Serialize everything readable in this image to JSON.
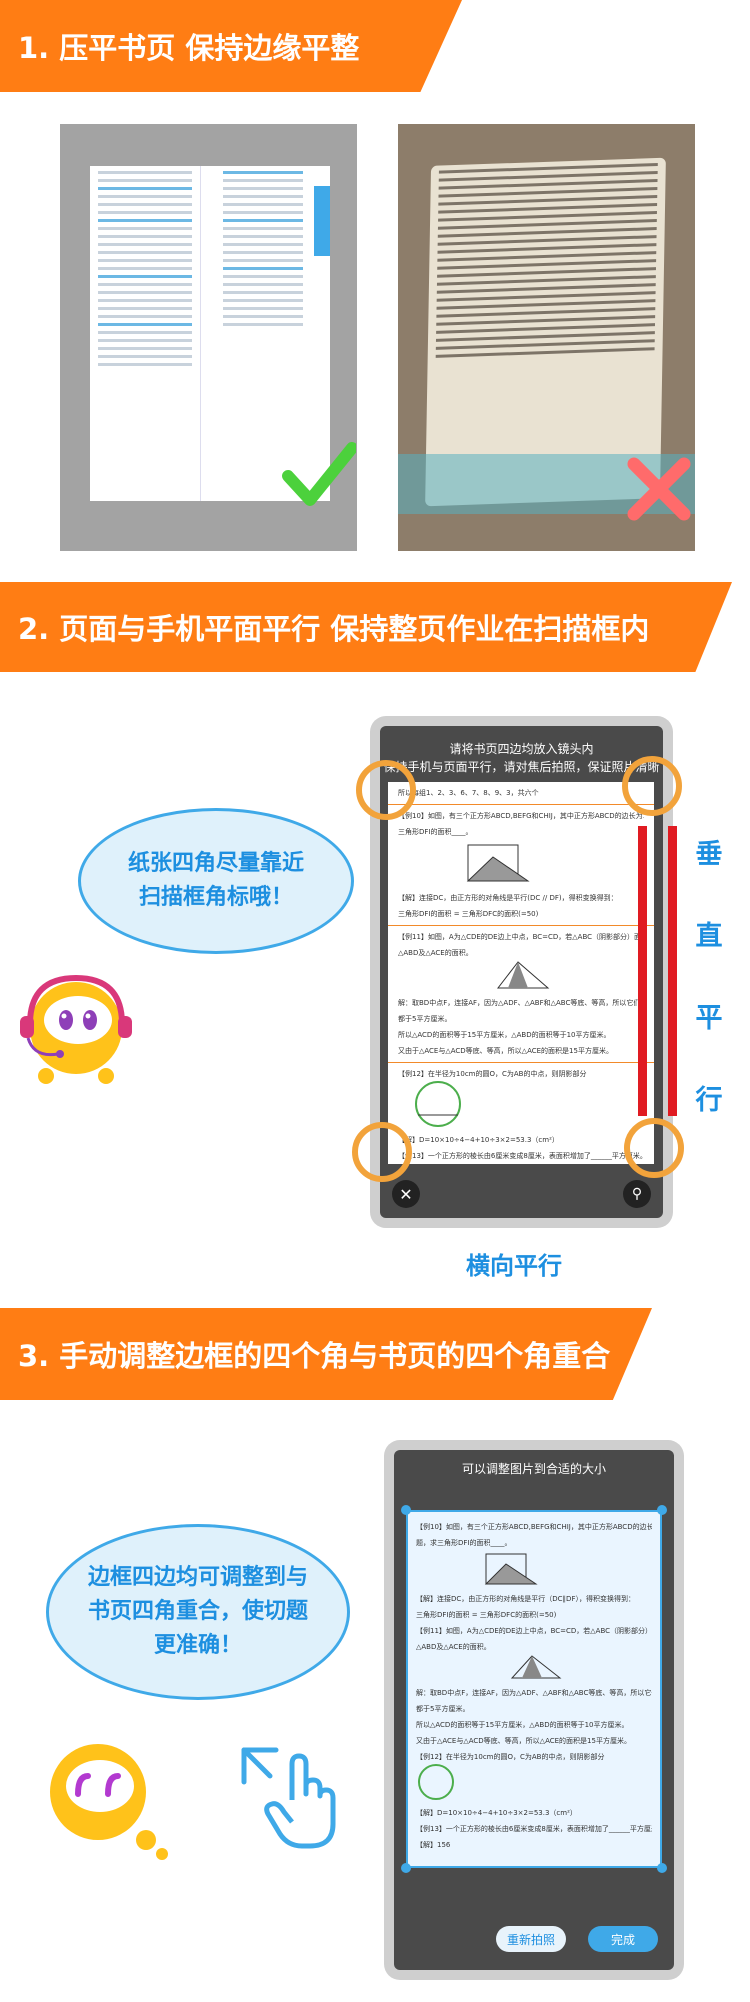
{
  "steps": [
    {
      "title": "1. 压平书页  保持边缘平整"
    },
    {
      "title": "2. 页面与手机平面平行  保持整页作业在扫描框内"
    },
    {
      "title": "3. 手动调整边框的四个角与书页的四个角重合"
    }
  ],
  "step2": {
    "hint_line1": "请将书页四边均放入镜头内",
    "hint_line2": "保持手机与页面平行，请对焦后拍照，保证照片清晰",
    "bubble_line1": "纸张四角尽量靠近",
    "bubble_line2": "扫描框角标哦！",
    "vertical_chars": [
      "垂",
      "直",
      "平",
      "行"
    ],
    "horizontal_label": "横向平行",
    "paper_lines": [
      "所以每组1、2、3、6、7、8、9、3，共六个",
      "【例10】如图，有三个正方形ABCD,BEFG和CHIJ，其中正方形ABCD的边长为10，正方形BEFG的边长",
      "三角形DFI的面积____。",
      "【解】连接DC，由正方形的对角线是平行(DC // DF)，得积变换得到：",
      "三角形DFI的面积 = 三角形DFC的面积(=50)",
      "【例11】如图，A为△CDE的DE边上中点，BC=CD，若△ABC（阴影部分）面积为5平方厘米，",
      "△ABD及△ACE的面积。",
      "解：取BD中点F，连接AF，因为△ADF、△ABF和△ABC等底、等高，所以它们的面积相等，",
      "都于5平方厘米。",
      "所以△ACD的面积等于15平方厘米，△ABD的面积等于10平方厘米。",
      "又由于△ACE与△ACD等底、等高，所以△ACE的面积是15平方厘米。",
      "【例12】在半径为10cm的圆O，C为AB的中点，则阴影部分",
      "【解】D=10×10÷4−4+10÷3×2=53.3（cm²）",
      "【例13】一个正方形的棱长由6厘米变成8厘米，表面积增加了______平方厘米。"
    ]
  },
  "step3": {
    "header": "可以调整图片到合适的大小",
    "bubble_line1": "边框四边均可调整到与",
    "bubble_line2": "书页四角重合，使切题",
    "bubble_line3": "更准确！",
    "retake_label": "重新拍照",
    "done_label": "完成",
    "paper_lines": [
      "【例10】如图，有三个正方形ABCD,BEFG和CHIJ，其中正方形ABCD的边长为10，正方形BEFG的边长为",
      "题，求三角形DFI的面积____。",
      "【解】连接DC，由正方形的对角线是平行（DC∥DF），得积变换得到：",
      "三角形DFI的面积 = 三角形DFC的面积(=50)",
      "【例11】如图，A为△CDE的DE边上中点，BC=CD，若△ABC（阴影部分）面积为5平方厘米，",
      "△ABD及△ACE的面积。",
      "解：取BD中点F，连接AF，因为△ADF、△ABF和△ABC等底、等高，所以它们的面积相等，",
      "都于5平方厘米。",
      "所以△ACD的面积等于15平方厘米，△ABD的面积等于10平方厘米。",
      "又由于△ACE与△ACD等底、等高，所以△ACE的面积是15平方厘米。",
      "【例12】在半径为10cm的圆O，C为AB的中点，则阴影部分",
      "【解】D=10×10÷4−4+10÷3×2=53.3（cm²）",
      "【例13】一个正方形的棱长由6厘米变成8厘米，表面积增加了______平方厘米。",
      "【解】156"
    ]
  },
  "colors": {
    "orange": "#ff7d14",
    "blue": "#1d8fe0",
    "good": "#4cd13c",
    "bad": "#ff6b6b",
    "red_line": "#e01b22"
  }
}
